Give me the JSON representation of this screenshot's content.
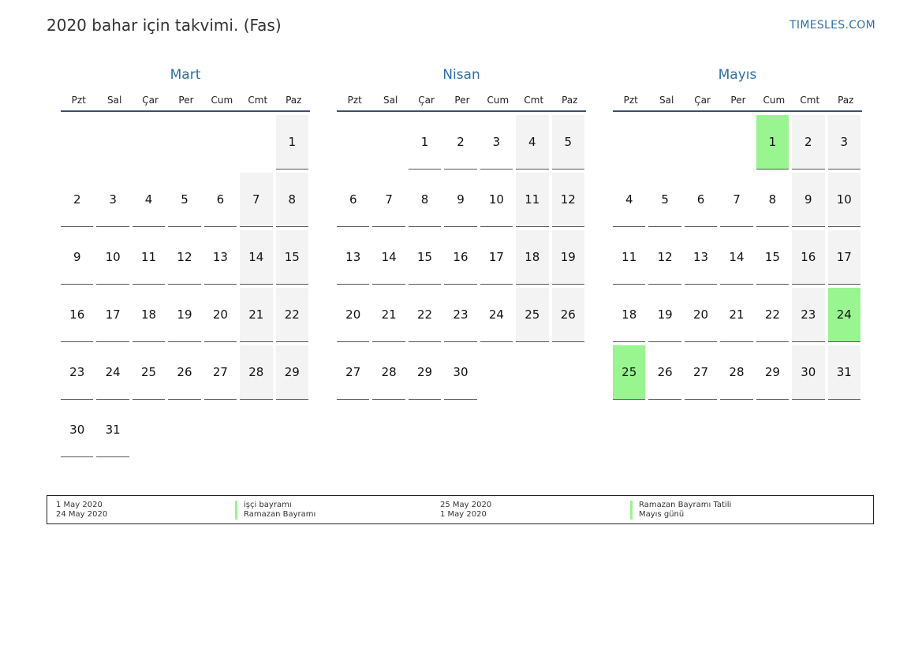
{
  "header": {
    "title": "2020 bahar için takvimi. (Fas)",
    "brand": "TIMESLES.COM"
  },
  "colors": {
    "accent": "#2f6fa8",
    "weekend": "#f3f3f3",
    "holiday": "#98f58f"
  },
  "weekdays": [
    "Pzt",
    "Sal",
    "Çar",
    "Per",
    "Cum",
    "Cmt",
    "Paz"
  ],
  "months": [
    {
      "name": "Mart",
      "weeks": [
        [
          "",
          "",
          "",
          "",
          "",
          "",
          "1"
        ],
        [
          "2",
          "3",
          "4",
          "5",
          "6",
          "7",
          "8"
        ],
        [
          "9",
          "10",
          "11",
          "12",
          "13",
          "14",
          "15"
        ],
        [
          "16",
          "17",
          "18",
          "19",
          "20",
          "21",
          "22"
        ],
        [
          "23",
          "24",
          "25",
          "26",
          "27",
          "28",
          "29"
        ],
        [
          "30",
          "31",
          "",
          "",
          "",
          "",
          ""
        ]
      ],
      "holidays": []
    },
    {
      "name": "Nisan",
      "weeks": [
        [
          "",
          "",
          "1",
          "2",
          "3",
          "4",
          "5"
        ],
        [
          "6",
          "7",
          "8",
          "9",
          "10",
          "11",
          "12"
        ],
        [
          "13",
          "14",
          "15",
          "16",
          "17",
          "18",
          "19"
        ],
        [
          "20",
          "21",
          "22",
          "23",
          "24",
          "25",
          "26"
        ],
        [
          "27",
          "28",
          "29",
          "30",
          "",
          "",
          ""
        ]
      ],
      "holidays": []
    },
    {
      "name": "Mayıs",
      "weeks": [
        [
          "",
          "",
          "",
          "",
          "1",
          "2",
          "3"
        ],
        [
          "4",
          "5",
          "6",
          "7",
          "8",
          "9",
          "10"
        ],
        [
          "11",
          "12",
          "13",
          "14",
          "15",
          "16",
          "17"
        ],
        [
          "18",
          "19",
          "20",
          "21",
          "22",
          "23",
          "24"
        ],
        [
          "25",
          "26",
          "27",
          "28",
          "29",
          "30",
          "31"
        ]
      ],
      "holidays": [
        "1",
        "24",
        "25"
      ]
    }
  ],
  "legend": {
    "col1": {
      "line1": "1 May 2020",
      "line2": "24 May 2020"
    },
    "col2": {
      "line1": "işçi bayramı",
      "line2": "Ramazan Bayramı"
    },
    "col3": {
      "line1": "25 May 2020",
      "line2": "1 May 2020"
    },
    "col4": {
      "line1": "Ramazan Bayramı Tatili",
      "line2": "Mayıs günü"
    }
  }
}
